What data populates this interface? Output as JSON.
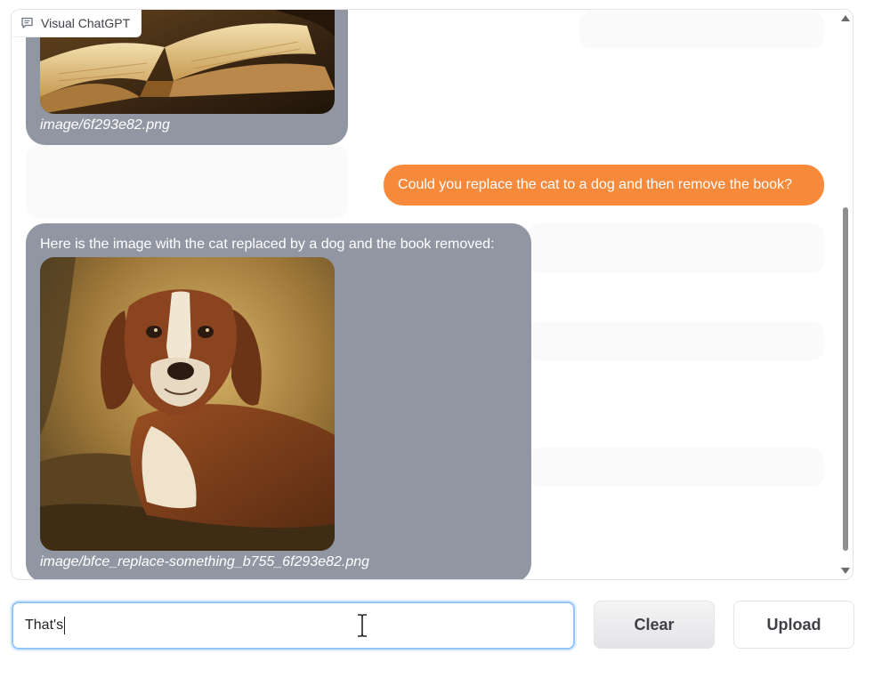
{
  "panel": {
    "label": "Visual ChatGPT",
    "label_icon": "chat-icon"
  },
  "messages": [
    {
      "role": "bot",
      "caption": "image/6f293e82.png",
      "image": "open-book-image"
    },
    {
      "role": "user",
      "text": "Could you replace the cat to a dog and then remove the book?"
    },
    {
      "role": "bot",
      "text": "Here is the image with the cat replaced by a dog and the book removed:",
      "caption": "image/bfce_replace-something_b755_6f293e82.png",
      "image": "dog-portrait-image"
    }
  ],
  "input": {
    "value": "That's",
    "placeholder": ""
  },
  "buttons": {
    "clear": "Clear",
    "upload": "Upload"
  },
  "colors": {
    "user_bubble": "#f7893b",
    "bot_bubble": "#9097a3",
    "focus_border": "#93c5fd"
  }
}
